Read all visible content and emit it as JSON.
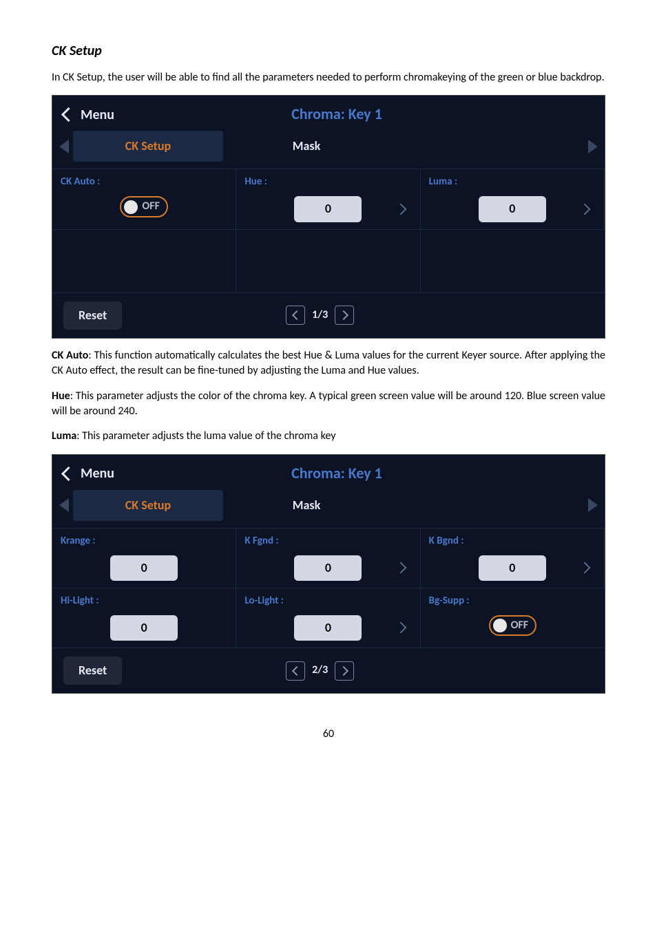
{
  "section_title": "CK Setup",
  "intro_text": "In CK Setup, the user will be able to find all the parameters needed to perform chromakeying of the green or blue backdrop.",
  "panel1": {
    "menu_label": "Menu",
    "title": "Chroma: Key 1",
    "tabs": {
      "active": "CK Setup",
      "next": "Mask"
    },
    "params": [
      {
        "label": "CK Auto :",
        "type": "toggle",
        "value": "OFF"
      },
      {
        "label": "Hue :",
        "type": "num",
        "value": "0",
        "chev": true
      },
      {
        "label": "Luma :",
        "type": "num",
        "value": "0",
        "chev": true
      }
    ],
    "reset_label": "Reset",
    "pager": "1/3"
  },
  "para_ckauto": {
    "bold": "CK Auto",
    "rest": ": This function automatically calculates the best Hue & Luma values for the current Keyer source. After applying the CK Auto effect, the result can be fine-tuned by adjusting the Luma and Hue values."
  },
  "para_hue": {
    "bold": "Hue",
    "rest": ": This parameter adjusts the color of the chroma key. A typical green screen value will be around 120. Blue screen value will be around 240."
  },
  "para_luma": {
    "bold": "Luma",
    "rest": ": This parameter adjusts the luma value of the chroma key"
  },
  "panel2": {
    "menu_label": "Menu",
    "title": "Chroma: Key 1",
    "tabs": {
      "active": "CK Setup",
      "next": "Mask"
    },
    "params_row1": [
      {
        "label": "Krange :",
        "type": "num",
        "value": "0"
      },
      {
        "label": "K Fgnd :",
        "type": "num",
        "value": "0",
        "chev": true
      },
      {
        "label": "K Bgnd :",
        "type": "num",
        "value": "0",
        "chev": true
      }
    ],
    "params_row2": [
      {
        "label": "Hi-Light :",
        "type": "num",
        "value": "0"
      },
      {
        "label": "Lo-Light :",
        "type": "num",
        "value": "0",
        "chev": true
      },
      {
        "label": "Bg-Supp :",
        "type": "toggle",
        "value": "OFF"
      }
    ],
    "reset_label": "Reset",
    "pager": "2/3"
  },
  "page_number": "60"
}
